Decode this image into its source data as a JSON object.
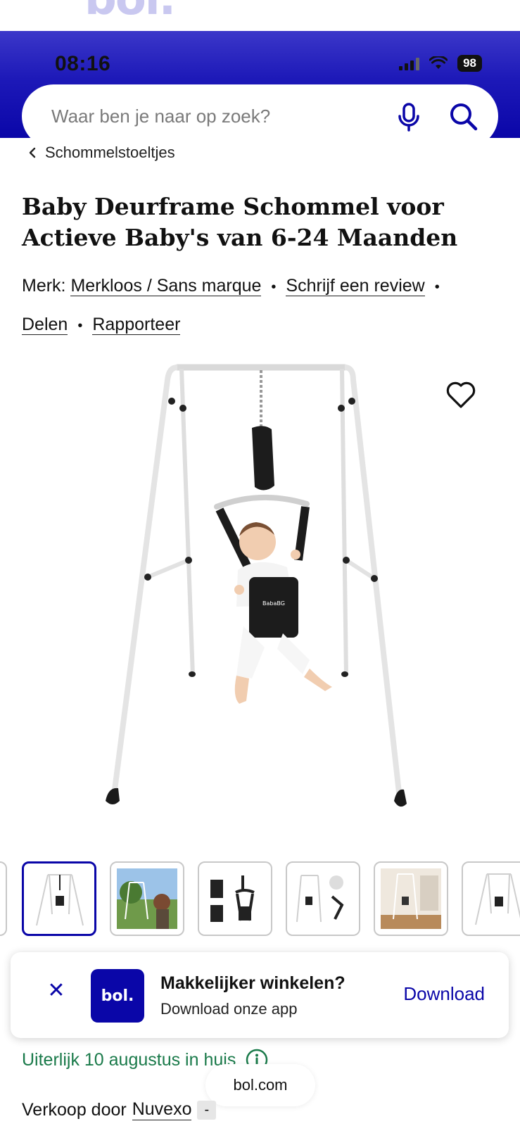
{
  "status_bar": {
    "time": "08:16",
    "battery": "98"
  },
  "header": {
    "peek_logo": "bol.",
    "search_placeholder": "Waar ben je naar op zoek?"
  },
  "breadcrumb": {
    "label": "Schommelstoeltjes"
  },
  "product": {
    "title": "Baby Deurframe Schommel voor Actieve Baby's van 6-24 Maanden",
    "brand_prefix": "Merk:",
    "brand": "Merkloos / Sans marque",
    "review_link": "Schrijf een review",
    "share_link": "Delen",
    "report_link": "Rapporteer",
    "jumper_logo_text": "BabaBG"
  },
  "thumbnails": {
    "count_visible": 6,
    "active_index": 0
  },
  "app_banner": {
    "logo_text": "bol.",
    "title": "Makkelijker winkelen?",
    "subtitle": "Download onze app",
    "action": "Download"
  },
  "delivery": {
    "text": "Uiterlijk 10 augustus in huis"
  },
  "browser": {
    "url": "bol.com"
  },
  "seller": {
    "prefix": "Verkoop door",
    "name": "Nuvexo",
    "badge": "-"
  },
  "colors": {
    "brand_blue": "#0a06a8",
    "delivery_green": "#1a7a4a"
  },
  "icons": [
    "mic-icon",
    "search-icon",
    "chevron-left-icon",
    "heart-icon",
    "close-icon",
    "info-icon"
  ]
}
